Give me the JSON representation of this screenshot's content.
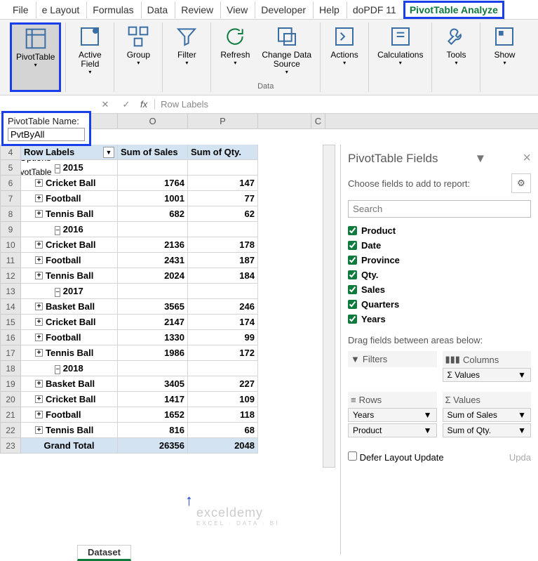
{
  "ribbon": {
    "tabs": [
      "File",
      "e Layout",
      "Formulas",
      "Data",
      "Review",
      "View",
      "Developer",
      "Help",
      "doPDF 11",
      "PivotTable Analyze"
    ],
    "active_tab": "PivotTable Analyze",
    "groups": {
      "data_label": "Data"
    },
    "buttons": {
      "pivottable": "PivotTable",
      "active_field": "Active\nField",
      "group": "Group",
      "filter": "Filter",
      "refresh": "Refresh",
      "change_data": "Change Data\nSource",
      "actions": "Actions",
      "calculations": "Calculations",
      "tools": "Tools",
      "show": "Show"
    }
  },
  "name_panel": {
    "label": "PivotTable Name:",
    "value": "PvtByAll",
    "options": "Options",
    "sublabel": "PivotTable"
  },
  "formula_bar": {
    "cancel": "✕",
    "confirm": "✓",
    "fx": "fx",
    "value": "Row Labels"
  },
  "columns": [
    "O",
    "P",
    "C"
  ],
  "pivot": {
    "headers": [
      "Row Labels",
      "Sum of Sales",
      "Sum of Qty."
    ],
    "rows": [
      {
        "num": 4,
        "type": "header"
      },
      {
        "num": 5,
        "type": "year",
        "label": "2015",
        "exp": "−"
      },
      {
        "num": 6,
        "type": "item",
        "label": "Cricket Ball",
        "sales": "1764",
        "qty": "147",
        "exp": "+"
      },
      {
        "num": 7,
        "type": "item",
        "label": "Football",
        "sales": "1001",
        "qty": "77",
        "exp": "+"
      },
      {
        "num": 8,
        "type": "item",
        "label": "Tennis Ball",
        "sales": "682",
        "qty": "62",
        "exp": "+"
      },
      {
        "num": 9,
        "type": "year",
        "label": "2016",
        "exp": "−"
      },
      {
        "num": 10,
        "type": "item",
        "label": "Cricket Ball",
        "sales": "2136",
        "qty": "178",
        "exp": "+"
      },
      {
        "num": 11,
        "type": "item",
        "label": "Football",
        "sales": "2431",
        "qty": "187",
        "exp": "+"
      },
      {
        "num": 12,
        "type": "item",
        "label": "Tennis Ball",
        "sales": "2024",
        "qty": "184",
        "exp": "+"
      },
      {
        "num": 13,
        "type": "year",
        "label": "2017",
        "exp": "−"
      },
      {
        "num": 14,
        "type": "item",
        "label": "Basket Ball",
        "sales": "3565",
        "qty": "246",
        "exp": "+"
      },
      {
        "num": 15,
        "type": "item",
        "label": "Cricket Ball",
        "sales": "2147",
        "qty": "174",
        "exp": "+"
      },
      {
        "num": 16,
        "type": "item",
        "label": "Football",
        "sales": "1330",
        "qty": "99",
        "exp": "+"
      },
      {
        "num": 17,
        "type": "item",
        "label": "Tennis Ball",
        "sales": "1986",
        "qty": "172",
        "exp": "+"
      },
      {
        "num": 18,
        "type": "year",
        "label": "2018",
        "exp": "−"
      },
      {
        "num": 19,
        "type": "item",
        "label": "Basket Ball",
        "sales": "3405",
        "qty": "227",
        "exp": "+"
      },
      {
        "num": 20,
        "type": "item",
        "label": "Cricket Ball",
        "sales": "1417",
        "qty": "109",
        "exp": "+"
      },
      {
        "num": 21,
        "type": "item",
        "label": "Football",
        "sales": "1652",
        "qty": "118",
        "exp": "+"
      },
      {
        "num": 22,
        "type": "item",
        "label": "Tennis Ball",
        "sales": "816",
        "qty": "68",
        "exp": "+"
      },
      {
        "num": 23,
        "type": "total",
        "label": "Grand Total",
        "sales": "26356",
        "qty": "2048"
      }
    ]
  },
  "fields_pane": {
    "title": "PivotTable Fields",
    "subtitle": "Choose fields to add to report:",
    "search_placeholder": "Search",
    "fields": [
      "Product",
      "Date",
      "Province",
      "Qty.",
      "Sales",
      "Quarters",
      "Years"
    ],
    "drag_label": "Drag fields between areas below:",
    "areas": {
      "filters": {
        "title": "Filters",
        "items": []
      },
      "columns": {
        "title": "Columns",
        "items": [
          "Σ Values"
        ]
      },
      "rows": {
        "title": "Rows",
        "items": [
          "Years",
          "Product"
        ]
      },
      "values": {
        "title": "Σ  Values",
        "items": [
          "Sum of Sales",
          "Sum of Qty."
        ]
      }
    },
    "defer": "Defer Layout Update",
    "update": "Upda"
  },
  "watermark": {
    "main": "exceldemy",
    "sub": "EXCEL · DATA · BI"
  },
  "sheet_tab": "Dataset"
}
